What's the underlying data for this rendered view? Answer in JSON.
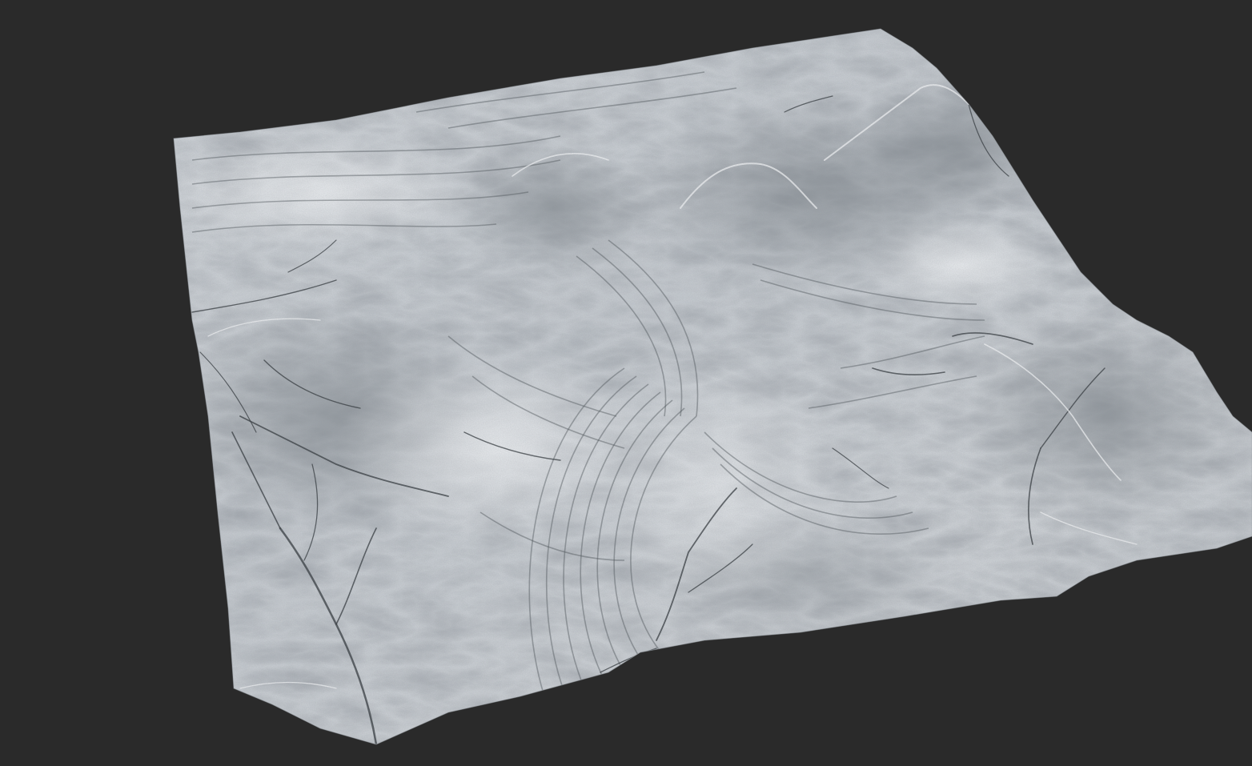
{
  "viewport": {
    "background_color": "#2a2a2a"
  },
  "terrain": {
    "kind": "grayscale heightmap mesh",
    "base_color": "#c9ced3",
    "light_color": "#eef1f3",
    "shadow_color": "#3a3f44",
    "features": [
      "mountain-ridge",
      "erosion-channels",
      "sediment-flow-bands",
      "drainage-network"
    ]
  }
}
